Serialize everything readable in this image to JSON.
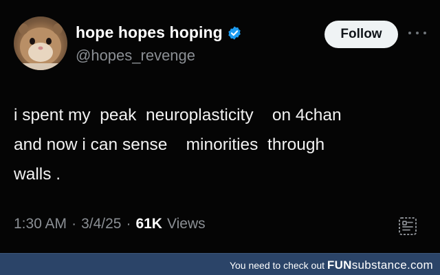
{
  "tweet": {
    "display_name": "hope hopes hoping",
    "handle": "@hopes_revenge",
    "follow_label": "Follow",
    "text": "i spent my  peak  neuroplasticity    on 4chan\nand now i can sense    minorities  through\nwalls .",
    "time": "1:30 AM",
    "separator": "·",
    "date": "3/4/25",
    "views_count": "61K",
    "views_label": "Views"
  },
  "footer": {
    "prefix": "You need to check out ",
    "brand_bold": "FUN",
    "brand_light": "substance",
    "brand_suffix": ".com"
  },
  "icons": {
    "verified": "verified-badge-icon",
    "more": "more-options-icon",
    "reader": "reader-mode-icon"
  },
  "colors": {
    "background": "#000000",
    "verified_blue": "#1d9bf0",
    "muted_text": "#8b8f94",
    "footer_bg": "#2b4468"
  }
}
